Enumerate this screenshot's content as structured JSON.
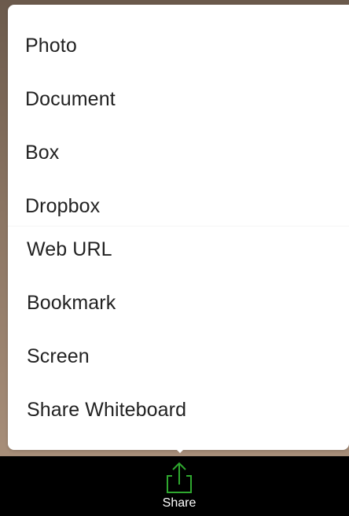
{
  "share_menu": {
    "items": [
      {
        "label": "Photo"
      },
      {
        "label": "Document"
      },
      {
        "label": "Box"
      },
      {
        "label": "Dropbox"
      },
      {
        "label": "Web URL"
      },
      {
        "label": "Bookmark"
      },
      {
        "label": "Screen"
      },
      {
        "label": "Share Whiteboard"
      }
    ]
  },
  "toolbar": {
    "share": {
      "label": "Share",
      "icon": "share-upload-icon",
      "icon_color": "#2fa82f"
    }
  },
  "colors": {
    "menu_background": "#ffffff",
    "menu_text": "#222222",
    "toolbar_background": "#000000",
    "toolbar_text": "#ffffff",
    "accent_green": "#2fa82f"
  }
}
